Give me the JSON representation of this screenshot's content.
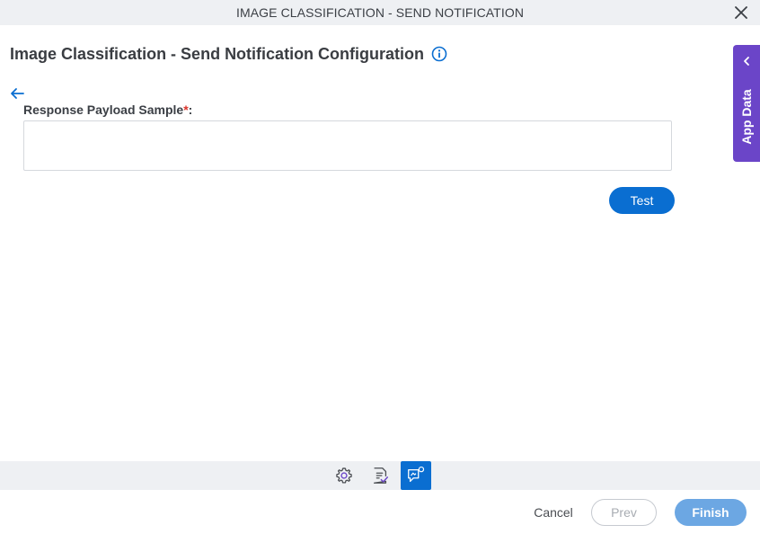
{
  "window": {
    "title": "IMAGE CLASSIFICATION - SEND NOTIFICATION",
    "close_icon": "close-icon"
  },
  "page": {
    "title": "Image Classification - Send Notification Configuration",
    "info_icon": "info-icon",
    "back_icon": "back-arrow-icon"
  },
  "form": {
    "payload_label": "Response Payload Sample",
    "required_marker": "*",
    "label_suffix": ":",
    "payload_value": "",
    "test_label": "Test"
  },
  "side_panel": {
    "label": "App Data",
    "chevron_icon": "chevron-left-icon",
    "color": "#6b45c8"
  },
  "toolbar": {
    "items": [
      {
        "icon": "gear-icon",
        "active": false
      },
      {
        "icon": "document-check-icon",
        "active": false
      },
      {
        "icon": "notification-chat-icon",
        "active": true
      }
    ]
  },
  "footer": {
    "cancel_label": "Cancel",
    "prev_label": "Prev",
    "finish_label": "Finish"
  },
  "colors": {
    "accent": "#0a6ed1",
    "required": "#d9342b",
    "finish_disabled": "#6ca7e3"
  }
}
